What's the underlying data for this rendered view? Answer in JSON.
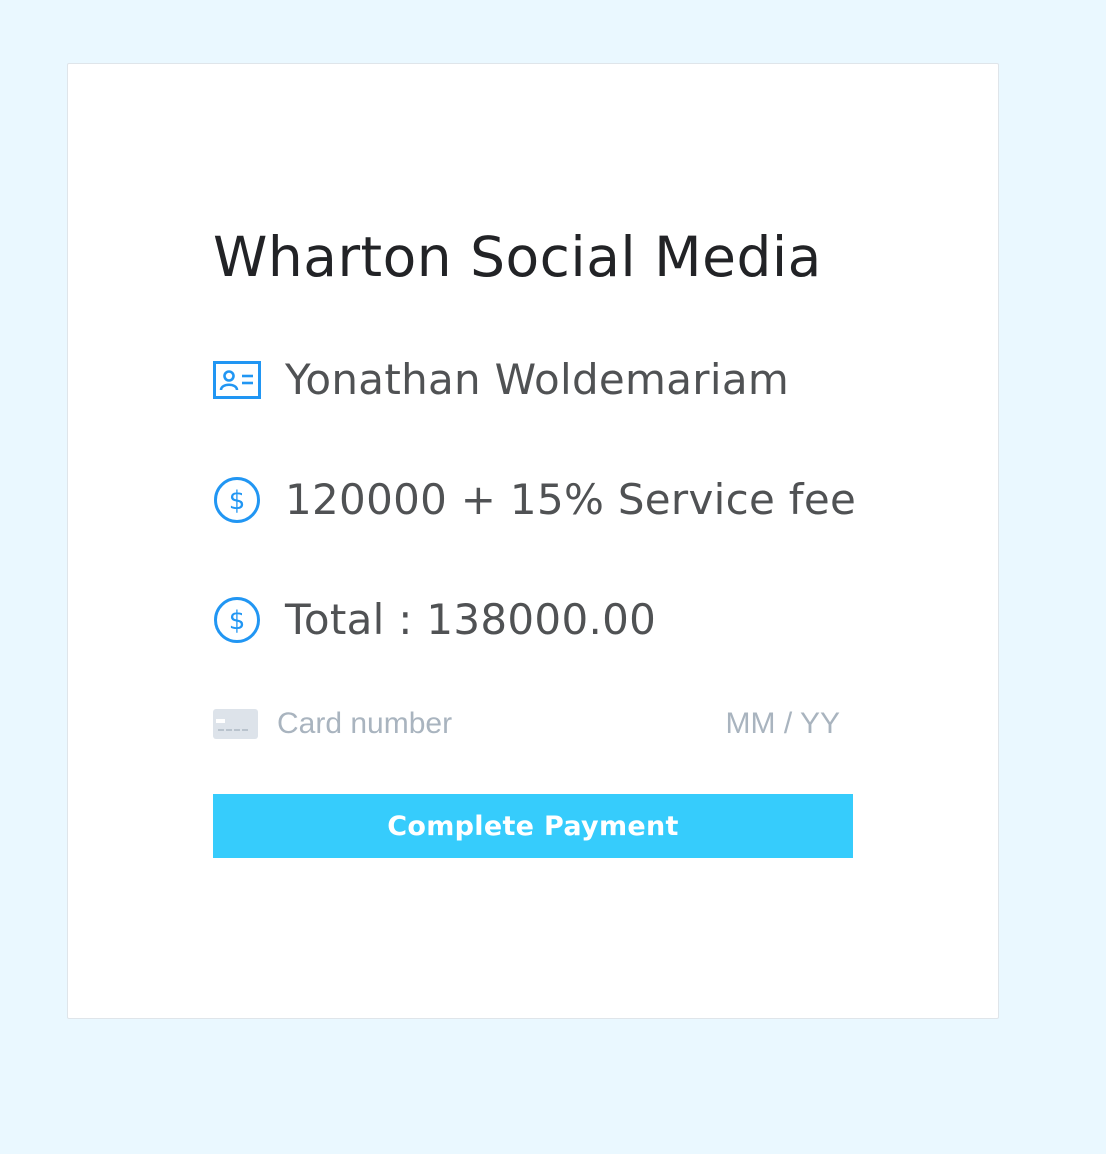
{
  "page": {
    "background_color": "#eaf8ff",
    "accent_color": "#2196f3",
    "button_color": "#36ccfc"
  },
  "payment": {
    "title": "Wharton Social Media",
    "name": "Yonathan Woldemariam",
    "name_icon": "id-card-icon",
    "fee": "120000 + 15% Service fee",
    "fee_icon": "dollar-circle-icon",
    "total": "Total : 138000.00",
    "total_icon": "dollar-circle-icon"
  },
  "card_input": {
    "icon": "credit-card-icon",
    "number_placeholder": "Card number",
    "expiry_placeholder": "MM / YY"
  },
  "button": {
    "label": "Complete Payment"
  }
}
